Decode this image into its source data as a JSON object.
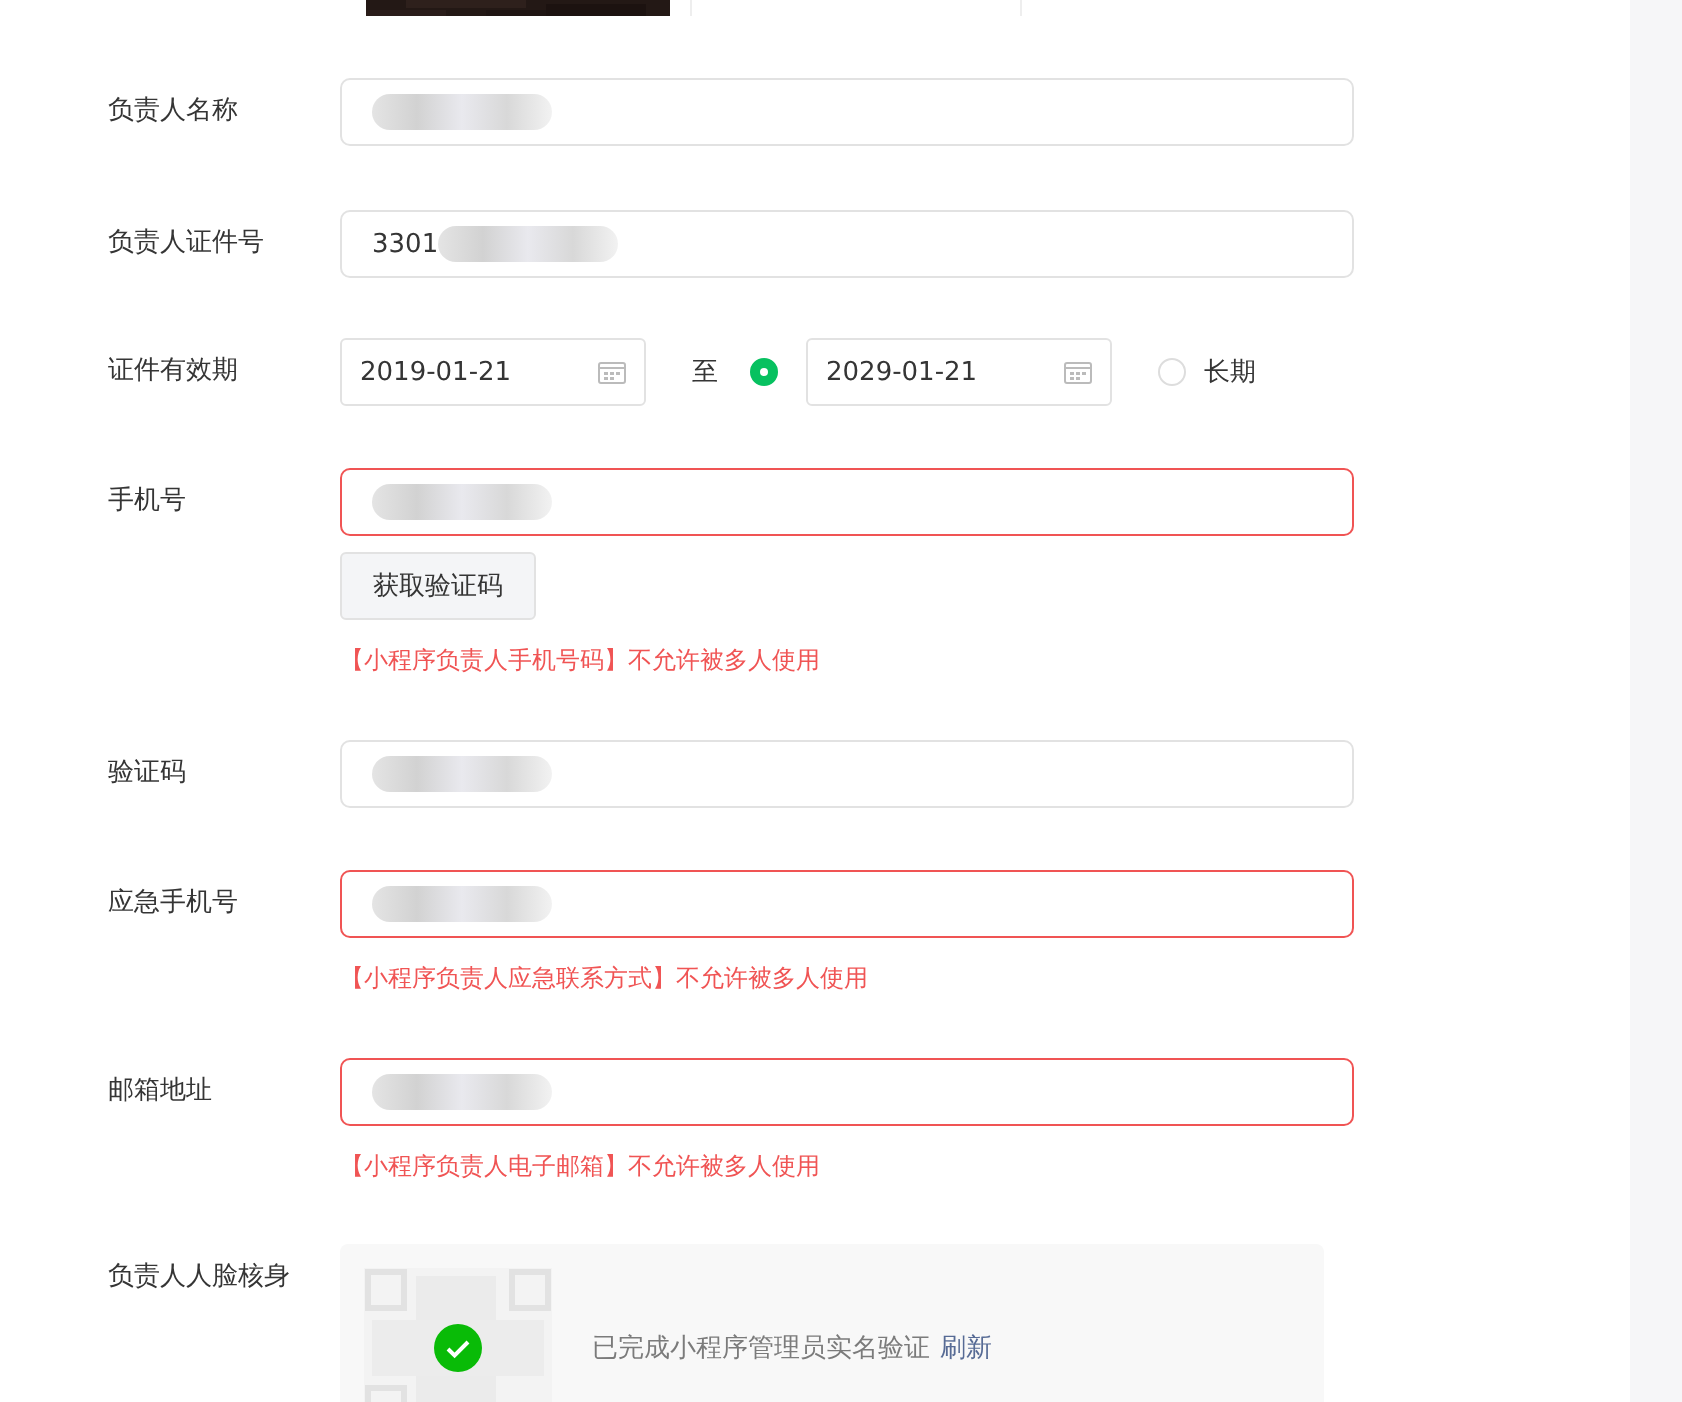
{
  "top_images": [
    {
      "kind": "picture"
    },
    {
      "kind": "blank"
    }
  ],
  "rows": [
    {
      "kind": "text",
      "label": "负责人名称",
      "field": {
        "masked": true,
        "error": false
      }
    },
    {
      "kind": "text",
      "label": "负责人证件号",
      "field": {
        "value": "3301",
        "masked": true,
        "error": false
      }
    },
    {
      "kind": "period",
      "label": "证件有效期",
      "start": "2019-01-21",
      "separator": "至",
      "end": "2029-01-21",
      "options": [
        {
          "selected": true
        },
        {
          "selected": false,
          "label": "长期"
        }
      ]
    },
    {
      "kind": "text",
      "label": "手机号",
      "field": {
        "masked": true,
        "error": true
      },
      "button": "获取验证码",
      "error_text": "【小程序负责人手机号码】不允许被多人使用"
    },
    {
      "kind": "text",
      "label": "验证码",
      "field": {
        "masked": true,
        "error": false
      }
    },
    {
      "kind": "text",
      "label": "应急手机号",
      "field": {
        "masked": true,
        "error": true
      },
      "error_text": "【小程序负责人应急联系方式】不允许被多人使用"
    },
    {
      "kind": "text",
      "label": "邮箱地址",
      "field": {
        "masked": true,
        "error": true
      },
      "error_text": "【小程序负责人电子邮箱】不允许被多人使用"
    },
    {
      "kind": "face",
      "label": "负责人人脸核身",
      "status": "已完成小程序管理员实名验证",
      "link": "刷新",
      "verified": true
    }
  ]
}
